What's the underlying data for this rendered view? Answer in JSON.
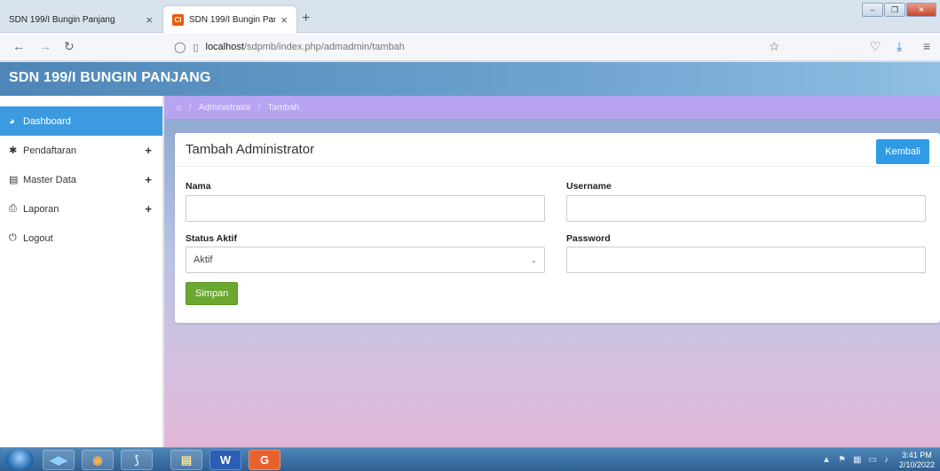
{
  "browser": {
    "tabs": [
      {
        "title": "SDN 199/I Bungin Panjang",
        "close": "×"
      },
      {
        "title": "SDN 199/I Bungin Panjang",
        "close": "×"
      }
    ],
    "new_tab": "+",
    "url_host": "localhost",
    "url_path": "/sdpmb/index.php/admadmin/tambah",
    "window_controls": [
      "–",
      "❐",
      "✕"
    ]
  },
  "app": {
    "brand": "SDN 199/I BUNGIN PANJANG"
  },
  "sidebar": {
    "items": [
      {
        "label": "Dashboard",
        "icon": "dashboard-icon",
        "glyph": "◕",
        "has_plus": false
      },
      {
        "label": "Pendaftaran",
        "icon": "gear-icon",
        "glyph": "✱",
        "has_plus": true
      },
      {
        "label": "Master Data",
        "icon": "database-icon",
        "glyph": "▤",
        "has_plus": true
      },
      {
        "label": "Laporan",
        "icon": "print-icon",
        "glyph": "⎙",
        "has_plus": true
      },
      {
        "label": "Logout",
        "icon": "power-icon",
        "glyph": "⏻",
        "has_plus": false
      }
    ],
    "plus": "+"
  },
  "breadcrumb": {
    "home_glyph": "⌂",
    "items": [
      "Administrator",
      "Tambah"
    ],
    "separator": "/"
  },
  "form": {
    "title": "Tambah Administrator",
    "back_label": "Kembali",
    "nama_label": "Nama",
    "nama_value": "",
    "username_label": "Username",
    "username_value": "",
    "status_label": "Status Aktif",
    "status_value": "Aktif",
    "password_label": "Password",
    "password_value": "",
    "save_label": "Simpan"
  },
  "taskbar": {
    "apps": [
      "◀▶",
      "◉",
      "⟆",
      "▤",
      "W",
      "G"
    ],
    "time": "3:41 PM",
    "date": "2/10/2022"
  }
}
